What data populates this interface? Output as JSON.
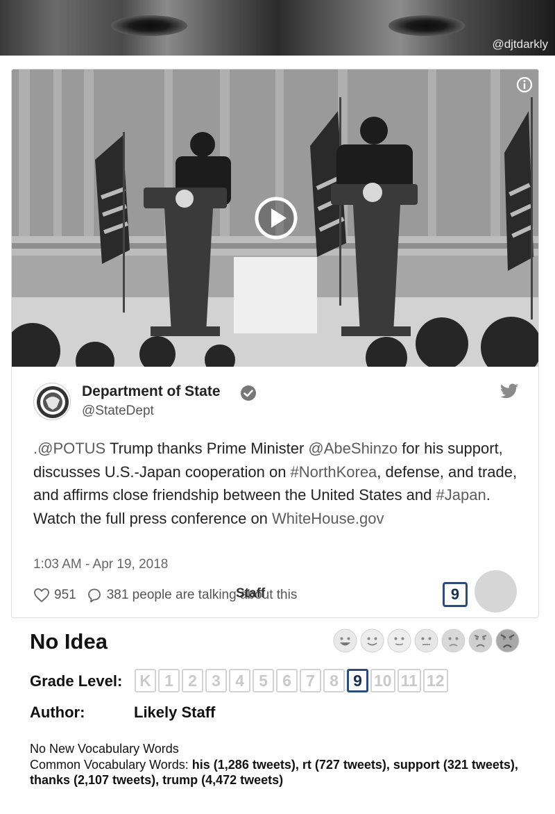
{
  "banner": {
    "handle": "@djtdarkly"
  },
  "card": {
    "video": {
      "info_icon": "info-icon",
      "play_icon": "play-icon"
    },
    "tweet": {
      "author_name": "Department of State",
      "author_handle": "@StateDept",
      "verified_icon": "verified-badge-icon",
      "platform_icon": "twitter-bird-icon",
      "text_segments": [
        {
          "text": ".@POTUS",
          "link": true
        },
        {
          "text": " Trump thanks Prime Minister ",
          "link": false
        },
        {
          "text": "@AbeShinzo",
          "link": true
        },
        {
          "text": " for his support, discusses U.S.-Japan cooperation on ",
          "link": false
        },
        {
          "text": "#NorthKorea",
          "link": true
        },
        {
          "text": ", defense, and trade, and affirms close friendship between the United States and ",
          "link": false
        },
        {
          "text": "#Japan",
          "link": true
        },
        {
          "text": ". Watch the full press conference on ",
          "link": false
        },
        {
          "text": "WhiteHouse.gov",
          "link": true
        }
      ],
      "timestamp": "1:03 AM - Apr 19, 2018",
      "likes": "951",
      "talking": "381 people are talking about this",
      "staff_overlay": "Staff",
      "grade_badge": "9"
    }
  },
  "verdict": "No Idea",
  "faces": [
    "very-happy-face-icon",
    "happy-face-icon",
    "slight-smile-face-icon",
    "neutral-face-icon",
    "frown-face-icon",
    "angry-face-icon",
    "very-angry-face-icon"
  ],
  "grade_level": {
    "label": "Grade Level:",
    "levels": [
      "K",
      "1",
      "2",
      "3",
      "4",
      "5",
      "6",
      "7",
      "8",
      "9",
      "10",
      "11",
      "12"
    ],
    "selected": "9"
  },
  "author": {
    "label": "Author:",
    "value": "Likely Staff"
  },
  "vocabulary": {
    "new_words": "No New Vocabulary Words",
    "common_label": "Common Vocabulary Words:",
    "common_words": "his (1,286 tweets), rt (727 tweets), support (321 tweets), thanks (2,107 tweets), trump (4,472 tweets)"
  },
  "colors": {
    "accent": "#2c4c7c",
    "grade_inactive": "#c9c9c9",
    "link_text": "#5c5c5c"
  }
}
